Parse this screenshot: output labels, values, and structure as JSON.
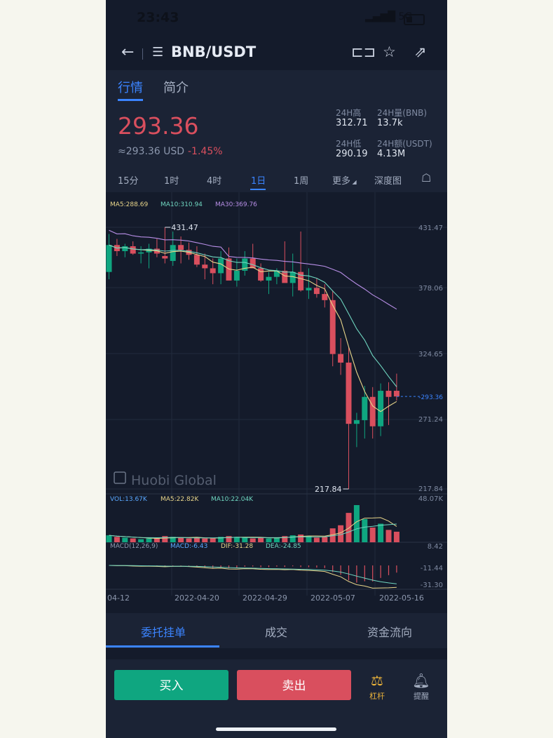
{
  "status_bar": {
    "time": "23:43",
    "network": "5G"
  },
  "header": {
    "pair": "BNB/USDT"
  },
  "tabs": [
    {
      "label": "行情"
    },
    {
      "label": "简介"
    }
  ],
  "price_info": {
    "price": "293.36",
    "usd": "≈293.36 USD",
    "change": "-1.45%",
    "high_label": "24H高",
    "high_value": "312.71",
    "vol_label": "24H量(BNB)",
    "vol_value": "13.7k",
    "low_label": "24H低",
    "low_value": "290.19",
    "amount_label": "24H额(USDT)",
    "amount_value": "4.13M"
  },
  "periods": [
    {
      "label": "15分"
    },
    {
      "label": "1时"
    },
    {
      "label": "4时"
    },
    {
      "label": "1日"
    },
    {
      "label": "1周"
    },
    {
      "label": "更多"
    },
    {
      "label": "深度图"
    }
  ],
  "chart": {
    "ma_legend": {
      "ma5": "MA5:288.69",
      "ma10": "MA10:310.94",
      "ma30": "MA30:369.76"
    },
    "y_ticks": [
      "431.47",
      "378.06",
      "324.65",
      "271.24",
      "217.84"
    ],
    "current_price_tag": "293.36",
    "max_label": "431.47",
    "min_label": "217.84",
    "watermark": "Huobi Global",
    "vol_legend": {
      "vol": "VOL:13.67K",
      "ma5": "MA5:22.82K",
      "ma10": "MA10:22.04K"
    },
    "vol_max": "48.07K",
    "macd_legend": {
      "macd_params": "MACD(12,26,9)",
      "macd": "MACD:-6.43",
      "dif": "DIF:-31.28",
      "dea": "DEA:-24.85"
    },
    "macd_ticks": [
      "8.42",
      "-11.44",
      "-31.30"
    ],
    "x_ticks": [
      "04-12",
      "2022-04-20",
      "2022-04-29",
      "2022-05-07",
      "2022-05-16"
    ],
    "colors": {
      "up": "#0fa680",
      "down": "#d94f5e",
      "ma5": "#e8d58a",
      "ma10": "#6fd6c0",
      "ma30": "#b78ee6"
    }
  },
  "chart_data": {
    "type": "candlestick",
    "x": [
      "2022-04-11",
      "2022-04-12",
      "2022-04-13",
      "2022-04-14",
      "2022-04-15",
      "2022-04-16",
      "2022-04-17",
      "2022-04-18",
      "2022-04-19",
      "2022-04-20",
      "2022-04-21",
      "2022-04-22",
      "2022-04-23",
      "2022-04-24",
      "2022-04-25",
      "2022-04-26",
      "2022-04-27",
      "2022-04-28",
      "2022-04-29",
      "2022-04-30",
      "2022-05-01",
      "2022-05-02",
      "2022-05-03",
      "2022-05-04",
      "2022-05-05",
      "2022-05-06",
      "2022-05-07",
      "2022-05-08",
      "2022-05-09",
      "2022-05-10",
      "2022-05-11",
      "2022-05-12",
      "2022-05-13",
      "2022-05-14",
      "2022-05-15",
      "2022-05-16",
      "2022-05-17"
    ],
    "open": [
      395,
      417,
      412,
      416,
      410,
      411,
      414,
      408,
      404,
      417,
      413,
      409,
      401,
      398,
      394,
      406,
      388,
      396,
      406,
      398,
      388,
      391,
      396,
      386,
      395,
      380,
      382,
      377,
      372,
      328,
      321,
      271,
      274,
      293,
      269,
      298,
      298
    ],
    "high": [
      426,
      422,
      418,
      420,
      416,
      418,
      422,
      431.47,
      428,
      424,
      419,
      416,
      410,
      406,
      412,
      415,
      406,
      412,
      418,
      402,
      395,
      398,
      420,
      410,
      428,
      398,
      390,
      385,
      380,
      341,
      334,
      280,
      302,
      301,
      304,
      305,
      312
    ],
    "low": [
      389,
      408,
      407,
      409,
      402,
      398,
      407,
      402,
      400,
      402,
      405,
      399,
      389,
      385,
      385,
      392,
      383,
      392,
      398,
      387,
      377,
      385,
      390,
      375,
      379,
      373,
      374,
      366,
      318,
      311,
      217.84,
      252,
      259,
      259,
      261,
      270,
      290
    ],
    "close": [
      417,
      412,
      416,
      410,
      411,
      414,
      410,
      406,
      417,
      413,
      409,
      401,
      398,
      394,
      406,
      388,
      396,
      406,
      398,
      388,
      391,
      396,
      386,
      395,
      380,
      382,
      377,
      372,
      328,
      321,
      271,
      274,
      293,
      269,
      298,
      293,
      293.36
    ],
    "volume": [
      9,
      7,
      6,
      5,
      4,
      5,
      5,
      8,
      7,
      6,
      5,
      6,
      5,
      5,
      7,
      8,
      7,
      6,
      5,
      6,
      5,
      6,
      8,
      9,
      10,
      8,
      6,
      7,
      18,
      22,
      38,
      48.07,
      30,
      19,
      24,
      16,
      13.67
    ],
    "y_range": [
      217.84,
      431.47
    ]
  }
}
